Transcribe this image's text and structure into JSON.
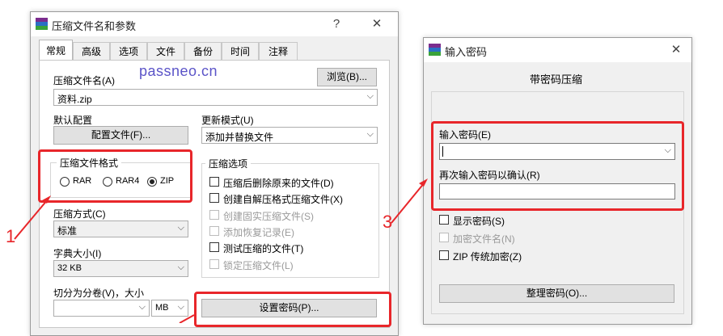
{
  "left_dialog": {
    "title": "压缩文件名和参数",
    "help_button": "?",
    "close_button": "✕",
    "tabs": [
      "常规",
      "高级",
      "选项",
      "文件",
      "备份",
      "时间",
      "注释"
    ],
    "archive_name_label": "压缩文件名(A)",
    "watermark": "passneo.cn",
    "browse_button": "浏览(B)...",
    "archive_name_value": "资料.zip",
    "default_config_label": "默认配置",
    "config_file_button": "配置文件(F)...",
    "update_mode_label": "更新模式(U)",
    "update_mode_value": "添加并替换文件",
    "archive_format_label": "压缩文件格式",
    "formats": [
      "RAR",
      "RAR4",
      "ZIP"
    ],
    "selected_format": "ZIP",
    "archive_options_label": "压缩选项",
    "options": [
      {
        "label": "压缩后删除原来的文件(D)",
        "enabled": true
      },
      {
        "label": "创建自解压格式压缩文件(X)",
        "enabled": true
      },
      {
        "label": "创建固实压缩文件(S)",
        "enabled": false
      },
      {
        "label": "添加恢复记录(E)",
        "enabled": false
      },
      {
        "label": "测试压缩的文件(T)",
        "enabled": true
      },
      {
        "label": "锁定压缩文件(L)",
        "enabled": false
      }
    ],
    "method_label": "压缩方式(C)",
    "method_value": "标准",
    "dict_size_label": "字典大小(I)",
    "dict_size_value": "32 KB",
    "split_label": "切分为分卷(V)，大小",
    "split_value": "",
    "split_unit": "MB",
    "set_password_button": "设置密码(P)..."
  },
  "right_dialog": {
    "title": "输入密码",
    "close_button": "✕",
    "heading": "带密码压缩",
    "enter_password_label": "输入密码(E)",
    "enter_password_value": "",
    "reenter_label": "再次输入密码以确认(R)",
    "reenter_value": "",
    "show_password_label": "显示密码(S)",
    "encrypt_names_label": "加密文件名(N)",
    "zip_legacy_label": "ZIP 传统加密(Z)",
    "organize_button": "整理密码(O)..."
  },
  "annotations": [
    "1",
    "3"
  ],
  "colors": {
    "highlight": "#e8262a",
    "watermark": "#5b54c8"
  }
}
